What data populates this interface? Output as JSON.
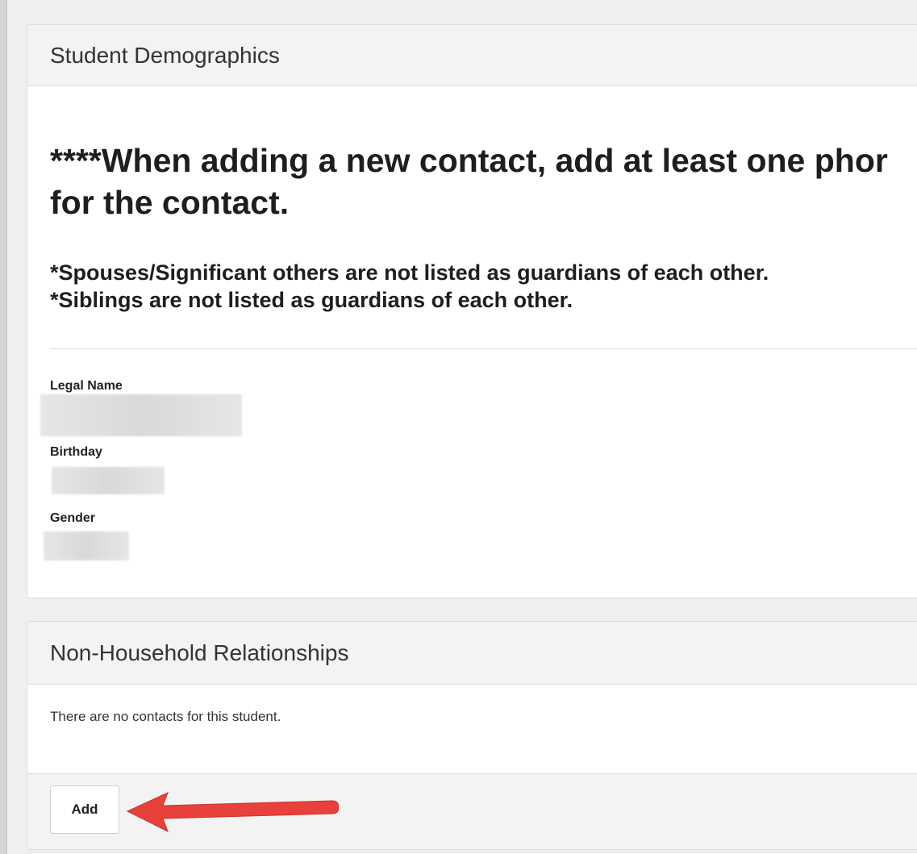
{
  "demographics": {
    "title": "Student Demographics",
    "notice_line1": "****When adding a new contact, add at least one phor",
    "notice_line2": "for the contact.",
    "rule1": "*Spouses/Significant others are not listed as guardians of each other.",
    "rule2": "*Siblings are not listed as guardians of each other.",
    "fields": {
      "legal_name_label": "Legal Name",
      "birthday_label": "Birthday",
      "gender_label": "Gender"
    }
  },
  "relationships": {
    "title": "Non-Household Relationships",
    "empty_message": "There are no contacts for this student.",
    "add_label": "Add"
  },
  "colors": {
    "annotation_arrow": "#e8413c",
    "panel_header_bg": "#f3f3f3",
    "page_bg": "#f0f0f0"
  },
  "icons": {
    "annotation": "red-arrow-pointing-left"
  }
}
